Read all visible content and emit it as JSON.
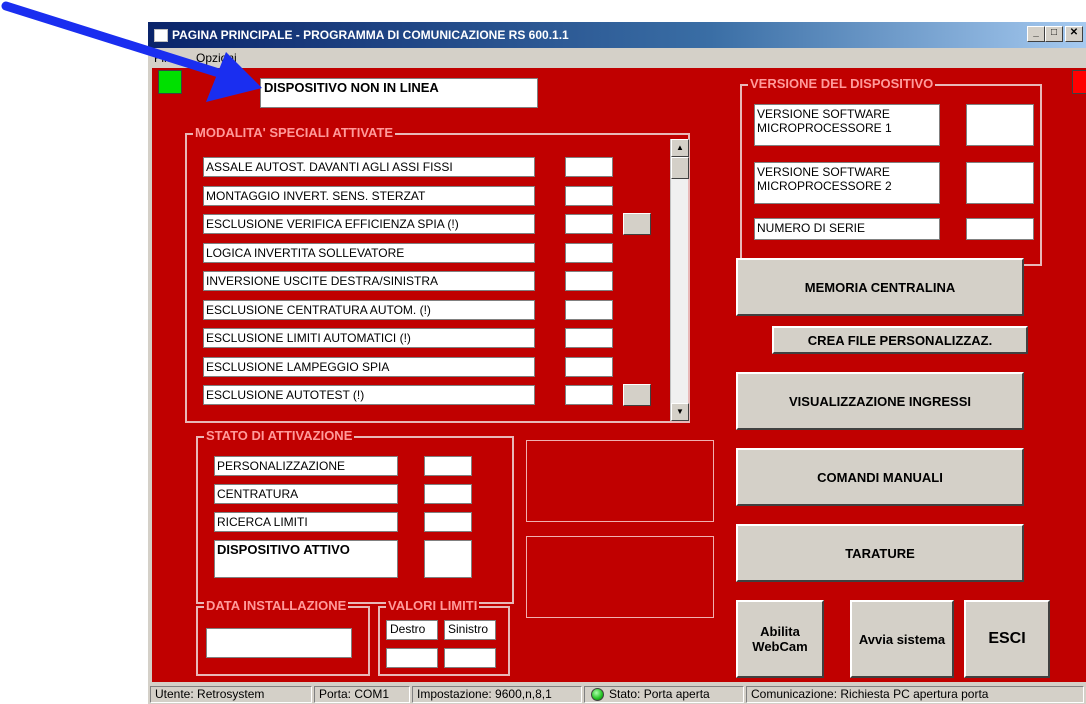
{
  "window": {
    "title": "PAGINA PRINCIPALE - PROGRAMMA DI COMUNICAZIONE  RS 600.1.1",
    "min_label": "_",
    "max_label": "□",
    "close_label": "✕"
  },
  "menu": [
    "File",
    "Opzioni"
  ],
  "device_status": "DISPOSITIVO NON IN LINEA",
  "special_modes": {
    "title": "MODALITA' SPECIALI ATTIVATE",
    "items": [
      {
        "label": "ASSALE AUTOST. DAVANTI AGLI ASSI FISSI",
        "value": "",
        "has_checkbox": false
      },
      {
        "label": "MONTAGGIO INVERT. SENS. STERZAT",
        "value": "",
        "has_checkbox": false
      },
      {
        "label": "ESCLUSIONE VERIFICA EFFICIENZA SPIA (!)",
        "value": "",
        "has_checkbox": true
      },
      {
        "label": "LOGICA INVERTITA SOLLEVATORE",
        "value": "",
        "has_checkbox": false
      },
      {
        "label": "INVERSIONE USCITE DESTRA/SINISTRA",
        "value": "",
        "has_checkbox": false
      },
      {
        "label": "ESCLUSIONE CENTRATURA AUTOM. (!)",
        "value": "",
        "has_checkbox": false
      },
      {
        "label": "ESCLUSIONE LIMITI AUTOMATICI (!)",
        "value": "",
        "has_checkbox": false
      },
      {
        "label": "ESCLUSIONE LAMPEGGIO SPIA",
        "value": "",
        "has_checkbox": false
      },
      {
        "label": "ESCLUSIONE AUTOTEST (!)",
        "value": "",
        "has_checkbox": true
      }
    ]
  },
  "device_version": {
    "title": "VERSIONE DEL DISPOSITIVO",
    "sw1_label": "VERSIONE SOFTWARE MICROPROCESSORE 1",
    "sw1_value": "",
    "sw2_label": "VERSIONE SOFTWARE MICROPROCESSORE 2",
    "sw2_value": "",
    "serial_label": "NUMERO DI SERIE",
    "serial_value": ""
  },
  "buttons": {
    "memoria": "MEMORIA CENTRALINA",
    "crea_file": "CREA FILE PERSONALIZZAZ.",
    "visualizzazione": "VISUALIZZAZIONE INGRESSI",
    "comandi": "COMANDI MANUALI",
    "tarature": "TARATURE",
    "webcam": "Abilita WebCam",
    "avvia": "Avvia sistema",
    "esci": "ESCI"
  },
  "activation": {
    "title": "STATO DI ATTIVAZIONE",
    "items": [
      {
        "label": "PERSONALIZZAZIONE",
        "value": ""
      },
      {
        "label": "CENTRATURA",
        "value": ""
      },
      {
        "label": "RICERCA LIMITI",
        "value": ""
      },
      {
        "label": "DISPOSITIVO ATTIVO",
        "value": ""
      }
    ]
  },
  "installation": {
    "title": "DATA INSTALLAZIONE",
    "value": ""
  },
  "limits": {
    "title": "VALORI LIMITI",
    "right_label": "Destro",
    "left_label": "Sinistro",
    "right_value": "",
    "left_value": ""
  },
  "statusbar": {
    "user": "Utente: Retrosystem",
    "port": "Porta: COM1",
    "settings": "Impostazione: 9600,n,8,1",
    "state": "Stato: Porta aperta",
    "comm": "Comunicazione: Richiesta PC apertura porta"
  },
  "colors": {
    "background": "#c00000",
    "indicator_left": "#00e000",
    "indicator_right": "#ff0000",
    "arrow": "#1a2ef0",
    "status_led": "#22c022"
  }
}
